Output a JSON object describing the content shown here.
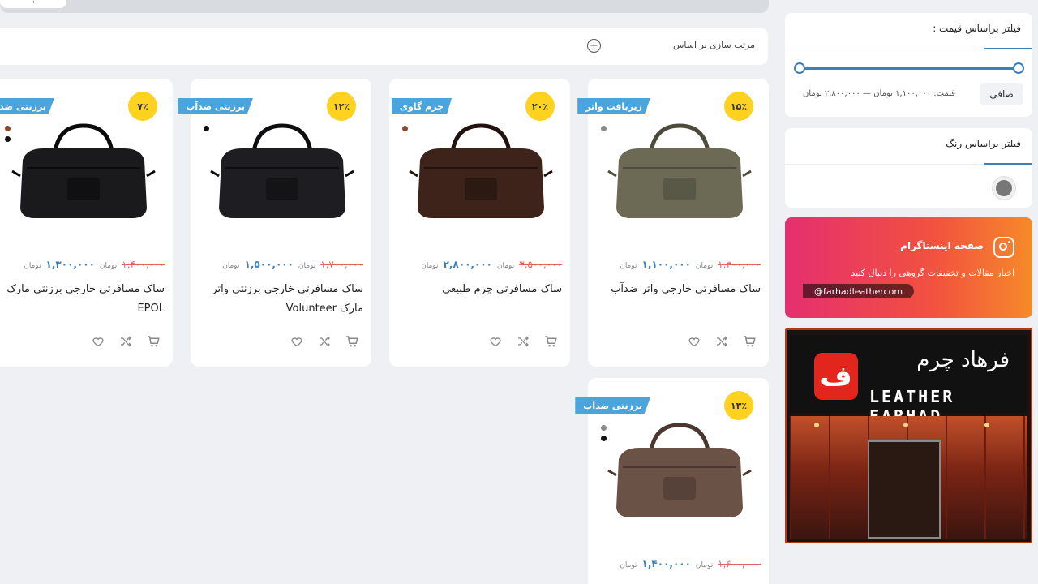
{
  "pager": {
    "prev": "‹",
    "label": ""
  },
  "sort": {
    "label": "مرتب سازی بر اساس",
    "toggle": "+"
  },
  "products": [
    {
      "discount": "۱۵٪",
      "tag": "زیربافت واتر",
      "swatches": [
        "#8a8a8a"
      ],
      "old_price": "۱,۳۰۰,۰۰۰",
      "price": "۱,۱۰۰,۰۰۰",
      "unit": "تومان",
      "title": "ساک مسافرتی خارجی واتر ضدآب",
      "image": "olive-duffel-bag"
    },
    {
      "discount": "۲۰٪",
      "tag": "چرم گاوی",
      "swatches": [
        "#8b4a2e"
      ],
      "old_price": "۳,۵۰۰,۰۰۰",
      "price": "۲,۸۰۰,۰۰۰",
      "unit": "تومان",
      "title": "ساک مسافرتی چرم طبیعی",
      "image": "brown-leather-bag"
    },
    {
      "discount": "۱۲٪",
      "tag": "برزنتی ضدآب",
      "swatches": [
        "#111111"
      ],
      "old_price": "۱,۷۰۰,۰۰۰",
      "price": "۱,۵۰۰,۰۰۰",
      "unit": "تومان",
      "title": "ساک مسافرتی خارجی برزنتی واتر مارک Volunteer",
      "image": "black-duffel-bag"
    },
    {
      "discount": "۷٪",
      "tag": "برزنتی ضدآب",
      "swatches": [
        "#8b4a2e",
        "#111111"
      ],
      "old_price": "۱,۴۰۰,۰۰۰",
      "price": "۱,۳۰۰,۰۰۰",
      "unit": "تومان",
      "title": "ساک مسافرتی خارجی برزنتی مارک EPOL",
      "image": "black-epol-bag"
    },
    {
      "discount": "۱۳٪",
      "tag": "برزنتی ضدآب",
      "swatches": [
        "#8a8a8a",
        "#111111"
      ],
      "old_price": "۱,۶۰۰,۰۰۰",
      "price": "۱,۴۰۰,۰۰۰",
      "unit": "تومان",
      "title": "",
      "image": "brown-canvas-bag"
    }
  ],
  "price_filter": {
    "title": "فیلتر براساس قیمت :",
    "button": "صافی",
    "range_text": "قیمت: ۱,۱۰۰,۰۰۰ تومان — ۲,۸۰۰,۰۰۰ تومان",
    "min_fraction": 0.0,
    "max_fraction": 1.0
  },
  "color_filter": {
    "title": "فیلتر براساس رنگ",
    "colors": [
      "#777777"
    ]
  },
  "instagram": {
    "title": "صفحه اینستاگرام",
    "description": "اخبار مقالات و تخفیفات گروهی را دنبال کنید",
    "handle": "@farhadleathercom"
  },
  "store": {
    "logo": "ف",
    "name_fa": "فرهاد چرم",
    "name_en": "LEATHER FARHAD"
  },
  "colors": {
    "accent": "#3d7fb8",
    "badge": "#ffd21f",
    "tag": "#4aa5dc",
    "old_price": "#e06666"
  }
}
